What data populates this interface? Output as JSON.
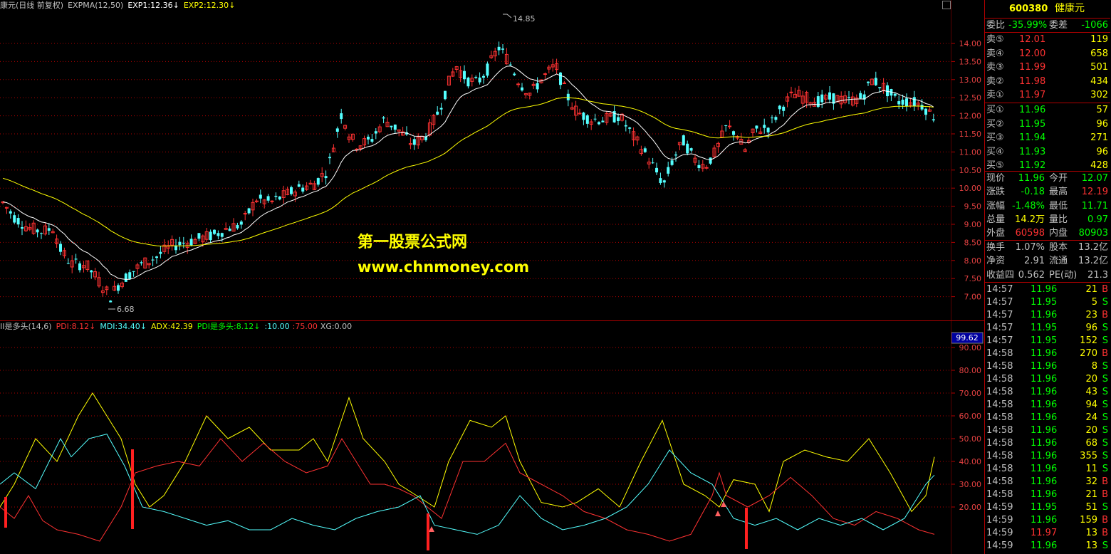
{
  "header": {
    "title": "康元(日线 前复权)",
    "expma": "EXPMA(12,50)",
    "exp1": "EXP1:12.36",
    "exp1_arrow": "↓",
    "exp2": "EXP2:12.30",
    "exp2_arrow": "↓"
  },
  "indicator_header": {
    "name": "II是多头(14,6)",
    "pdi": "PDI:8.12",
    "pdi_arrow": "↓",
    "mdi": "MDI:34.40",
    "mdi_arrow": "↓",
    "adx": "ADX:42.39",
    "pdi2": "PDI是多头:8.12",
    "pdi2_arrow": "↓",
    "l10": ":10.00",
    "l75": ":75.00",
    "xg": "XG:0.00"
  },
  "watermark": {
    "line1": "第一股票公式网",
    "line2": "www.chnmoney.com"
  },
  "price_axis": [
    "14.00",
    "13.50",
    "13.00",
    "12.50",
    "12.00",
    "11.50",
    "11.00",
    "10.50",
    "10.00",
    "9.50",
    "9.00",
    "8.50",
    "8.00",
    "7.50",
    "7.00"
  ],
  "indicator_axis": [
    "99.62",
    "90.00",
    "80.00",
    "70.00",
    "60.00",
    "50.00",
    "40.00",
    "30.00",
    "20.00"
  ],
  "high_marker": "14.85",
  "low_marker": "6.68",
  "colors": {
    "up": "#ff3232",
    "down": "#54ffff",
    "exp1": "#ffffff",
    "exp2": "#ffff00",
    "pdi": "#ff3232",
    "mdi": "#54ffff",
    "adx": "#ffff00",
    "grid": "#b00000"
  },
  "quote": {
    "code": "600380",
    "name": "健康元",
    "weibi_label": "委比",
    "weibi": "-35.99%",
    "weicha_label": "委差",
    "weicha": "-1066",
    "asks": [
      {
        "label": "卖⑤",
        "price": "12.01",
        "vol": "119"
      },
      {
        "label": "卖④",
        "price": "12.00",
        "vol": "658"
      },
      {
        "label": "卖③",
        "price": "11.99",
        "vol": "501"
      },
      {
        "label": "卖②",
        "price": "11.98",
        "vol": "434"
      },
      {
        "label": "卖①",
        "price": "11.97",
        "vol": "302"
      }
    ],
    "bids": [
      {
        "label": "买①",
        "price": "11.96",
        "vol": "57"
      },
      {
        "label": "买②",
        "price": "11.95",
        "vol": "96"
      },
      {
        "label": "买③",
        "price": "11.94",
        "vol": "271"
      },
      {
        "label": "买④",
        "price": "11.93",
        "vol": "96"
      },
      {
        "label": "买⑤",
        "price": "11.92",
        "vol": "428"
      }
    ],
    "stats": [
      {
        "l1": "现价",
        "v1": "11.96",
        "c1": "#00ff00",
        "l2": "今开",
        "v2": "12.07",
        "c2": "#00ff00"
      },
      {
        "l1": "涨跌",
        "v1": "-0.18",
        "c1": "#00ff00",
        "l2": "最高",
        "v2": "12.19",
        "c2": "#ff3232"
      },
      {
        "l1": "涨幅",
        "v1": "-1.48%",
        "c1": "#00ff00",
        "l2": "最低",
        "v2": "11.71",
        "c2": "#00ff00"
      },
      {
        "l1": "总量",
        "v1": "14.2万",
        "c1": "#ffff00",
        "l2": "量比",
        "v2": "0.97",
        "c2": "#00ff00"
      },
      {
        "l1": "外盘",
        "v1": "60598",
        "c1": "#ff3232",
        "l2": "内盘",
        "v2": "80903",
        "c2": "#00ff00"
      }
    ],
    "stats2": [
      {
        "l1": "换手",
        "v1": "1.07%",
        "l2": "股本",
        "v2": "13.2亿"
      },
      {
        "l1": "净资",
        "v1": "2.91",
        "l2": "流通",
        "v2": "13.2亿"
      },
      {
        "l1": "收益四",
        "v1": "0.562",
        "l2": "PE(动)",
        "v2": "21.3"
      }
    ]
  },
  "ticks": [
    {
      "t": "14:57",
      "p": "11.96",
      "q": "21",
      "s": "B"
    },
    {
      "t": "14:57",
      "p": "11.95",
      "q": "5",
      "s": "S"
    },
    {
      "t": "14:57",
      "p": "11.96",
      "q": "23",
      "s": "B"
    },
    {
      "t": "14:57",
      "p": "11.95",
      "q": "96",
      "s": "S"
    },
    {
      "t": "14:57",
      "p": "11.95",
      "q": "152",
      "s": "S"
    },
    {
      "t": "14:58",
      "p": "11.96",
      "q": "270",
      "s": "B"
    },
    {
      "t": "14:58",
      "p": "11.96",
      "q": "8",
      "s": "S"
    },
    {
      "t": "14:58",
      "p": "11.96",
      "q": "20",
      "s": "S"
    },
    {
      "t": "14:58",
      "p": "11.96",
      "q": "43",
      "s": "S"
    },
    {
      "t": "14:58",
      "p": "11.96",
      "q": "94",
      "s": "S"
    },
    {
      "t": "14:58",
      "p": "11.96",
      "q": "24",
      "s": "S"
    },
    {
      "t": "14:58",
      "p": "11.96",
      "q": "20",
      "s": "S"
    },
    {
      "t": "14:58",
      "p": "11.96",
      "q": "68",
      "s": "S"
    },
    {
      "t": "14:58",
      "p": "11.96",
      "q": "355",
      "s": "S"
    },
    {
      "t": "14:58",
      "p": "11.96",
      "q": "11",
      "s": "S"
    },
    {
      "t": "14:58",
      "p": "11.96",
      "q": "32",
      "s": "B"
    },
    {
      "t": "14:58",
      "p": "11.96",
      "q": "21",
      "s": "B"
    },
    {
      "t": "14:59",
      "p": "11.95",
      "q": "51",
      "s": "S"
    },
    {
      "t": "14:59",
      "p": "11.96",
      "q": "159",
      "s": "B"
    },
    {
      "t": "14:59",
      "p": "11.97",
      "q": "13",
      "s": "B"
    },
    {
      "t": "14:59",
      "p": "11.96",
      "q": "13",
      "s": "S"
    }
  ]
}
